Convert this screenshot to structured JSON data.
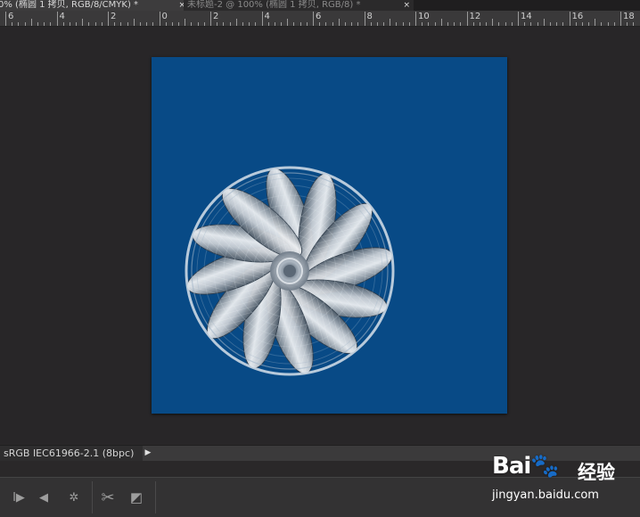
{
  "tabs": [
    {
      "label": "0% (椭圆 1 拷贝, RGB/8/CMYK) *",
      "close": "×",
      "active": true
    },
    {
      "label": "未标题-2 @ 100% (椭圆 1 拷贝, RGB/8) *",
      "close": "×",
      "active": false
    }
  ],
  "ruler": {
    "labels": [
      "6",
      "4",
      "2",
      "0",
      "2",
      "4",
      "6",
      "8",
      "10",
      "12",
      "14",
      "16",
      "18"
    ]
  },
  "document": {
    "background": "#084a86",
    "artwork": "pinwheel-flower-in-ring"
  },
  "status": {
    "profile": "sRGB IEC61966-2.1 (8bpc)",
    "arrow": "▶"
  },
  "bottom_tools": [
    {
      "name": "play-frame-icon",
      "glyph": "I▶"
    },
    {
      "name": "speaker-icon",
      "glyph": "◀"
    },
    {
      "name": "settings-icon",
      "glyph": "✲"
    },
    {
      "name": "scissors-icon",
      "glyph": "✂"
    },
    {
      "name": "transition-icon",
      "glyph": "◩"
    }
  ],
  "watermark": {
    "logo": "Bai🐾",
    "cn": "经验",
    "url": "jingyan.baidu.com"
  }
}
